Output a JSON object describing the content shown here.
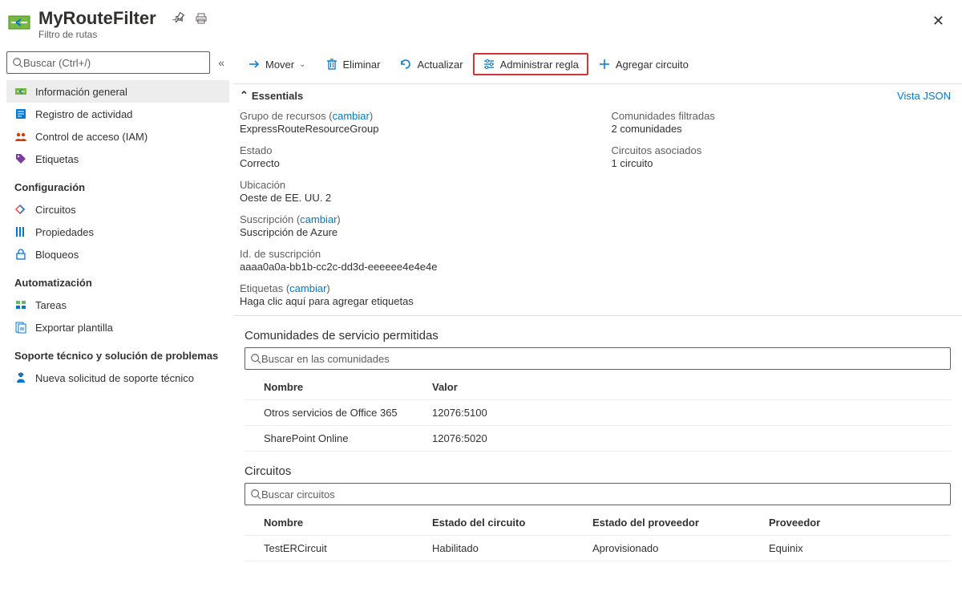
{
  "header": {
    "title": "MyRouteFilter",
    "subtitle": "Filtro de rutas"
  },
  "sidebar": {
    "search_placeholder": "Buscar (Ctrl+/)",
    "items_top": [
      {
        "label": "Información general",
        "icon": "overview"
      },
      {
        "label": "Registro de actividad",
        "icon": "log"
      },
      {
        "label": "Control de acceso (IAM)",
        "icon": "iam"
      },
      {
        "label": "Etiquetas",
        "icon": "tag"
      }
    ],
    "section_config": "Configuración",
    "items_config": [
      {
        "label": "Circuitos",
        "icon": "circuit"
      },
      {
        "label": "Propiedades",
        "icon": "props"
      },
      {
        "label": "Bloqueos",
        "icon": "lock"
      }
    ],
    "section_auto": "Automatización",
    "items_auto": [
      {
        "label": "Tareas",
        "icon": "tasks"
      },
      {
        "label": "Exportar plantilla",
        "icon": "export"
      }
    ],
    "section_support": "Soporte técnico y solución de problemas",
    "items_support": [
      {
        "label": "Nueva solicitud de soporte técnico",
        "icon": "support"
      }
    ]
  },
  "toolbar": {
    "move": "Mover",
    "delete": "Eliminar",
    "refresh": "Actualizar",
    "manage_rule": "Administrar regla",
    "add_circuit": "Agregar circuito"
  },
  "essentials": {
    "toggle_label": "Essentials",
    "json_view": "Vista JSON",
    "resource_group_label": "Grupo de recursos",
    "change": "cambiar",
    "resource_group_value": "ExpressRouteResourceGroup",
    "state_label": "Estado",
    "state_value": "Correcto",
    "location_label": "Ubicación",
    "location_value": "Oeste de EE. UU. 2",
    "subscription_label": "Suscripción",
    "subscription_value": "Suscripción de Azure",
    "sub_id_label": "Id. de suscripción",
    "sub_id_value": "aaaa0a0a-bb1b-cc2c-dd3d-eeeeee4e4e4e",
    "tags_label": "Etiquetas",
    "tags_value": "Haga clic aquí para agregar etiquetas",
    "communities_label": "Comunidades filtradas",
    "communities_value": "2 comunidades",
    "circuits_label": "Circuitos asociados",
    "circuits_value": "1 circuito"
  },
  "communities": {
    "title": "Comunidades de servicio permitidas",
    "search_placeholder": "Buscar en las comunidades",
    "col_name": "Nombre",
    "col_value": "Valor",
    "rows": [
      {
        "name": "Otros servicios de Office 365",
        "value": "12076:5100"
      },
      {
        "name": "SharePoint Online",
        "value": "12076:5020"
      }
    ]
  },
  "circuits": {
    "title": "Circuitos",
    "search_placeholder": "Buscar circuitos",
    "col_name": "Nombre",
    "col_state": "Estado del circuito",
    "col_provstate": "Estado del proveedor",
    "col_vendor": "Proveedor",
    "rows": [
      {
        "name": "TestERCircuit",
        "state": "Habilitado",
        "provstate": "Aprovisionado",
        "vendor": "Equinix"
      }
    ]
  }
}
